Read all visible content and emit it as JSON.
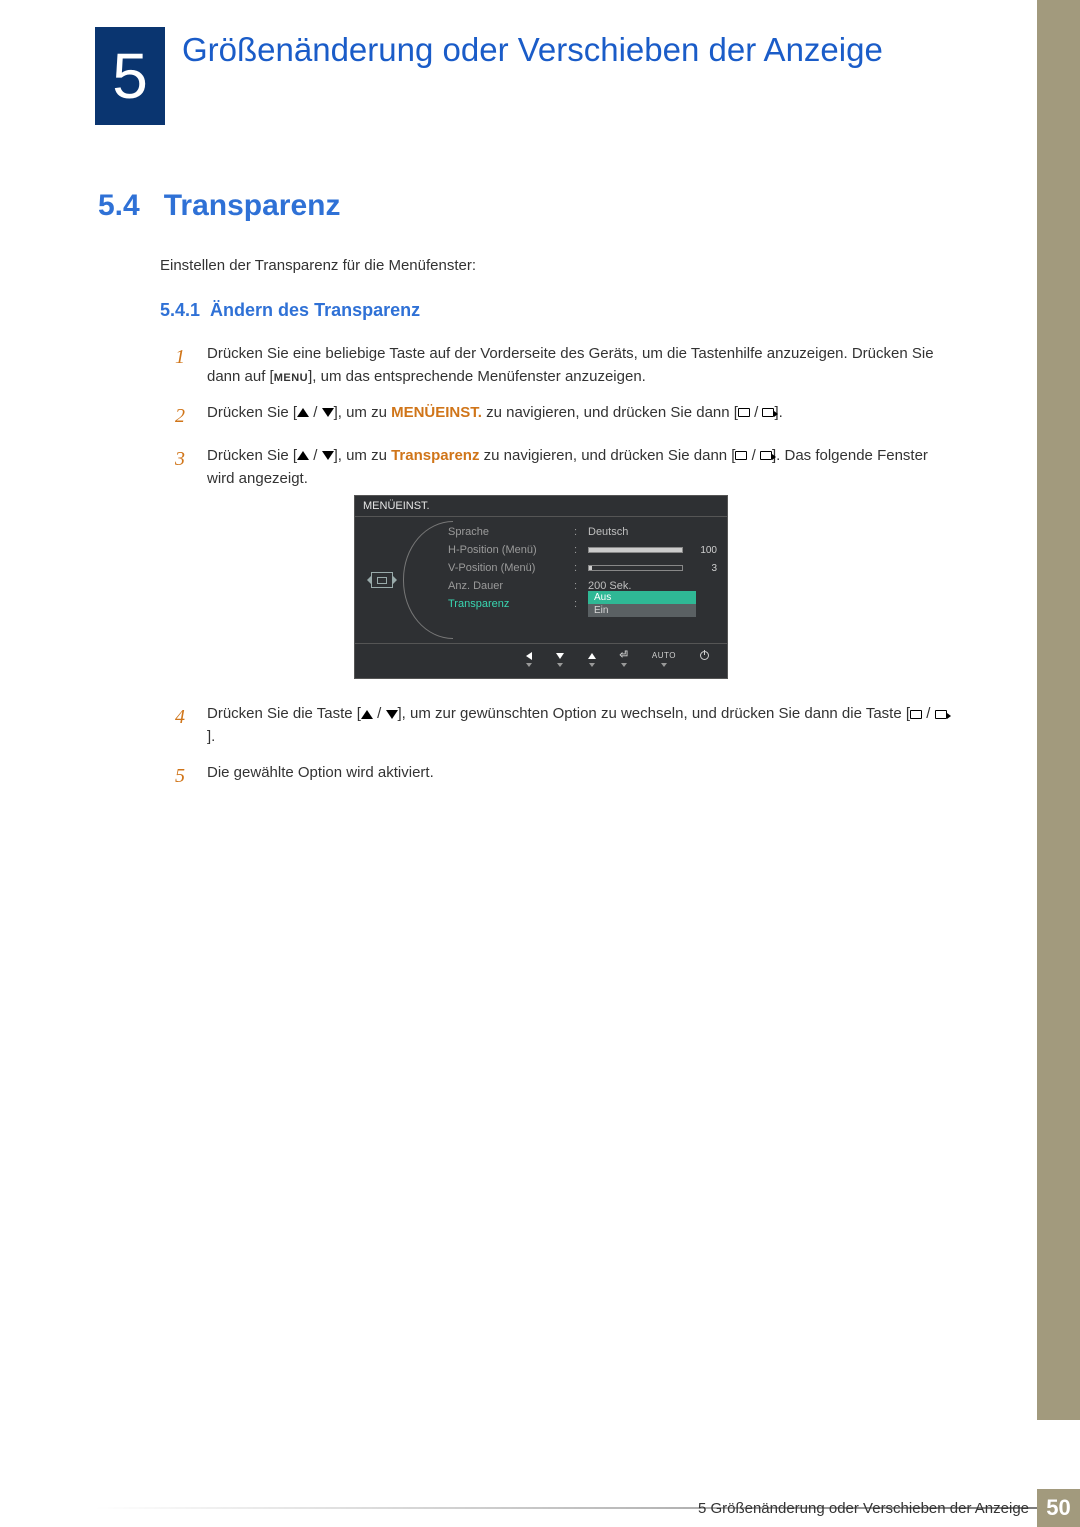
{
  "chapter": {
    "number": "5",
    "title": "Größenänderung oder Verschieben der Anzeige"
  },
  "section": {
    "number": "5.4",
    "title": "Transparenz"
  },
  "intro": "Einstellen der Transparenz für die Menüfenster:",
  "subsection": {
    "number": "5.4.1",
    "title": "Ändern des Transparenz"
  },
  "steps": {
    "s1_a": "Drücken Sie eine beliebige Taste auf der Vorderseite des Geräts, um die Tastenhilfe anzuzeigen. Drücken Sie dann auf [",
    "s1_menu": "MENU",
    "s1_b": "], um das entsprechende Menüfenster anzuzeigen.",
    "s2_a": "Drücken Sie [",
    "s2_b": "], um zu ",
    "s2_target": "MENÜEINST.",
    "s2_c": " zu navigieren, und drücken Sie dann [",
    "s2_d": "].",
    "s3_a": "Drücken Sie [",
    "s3_b": "], um zu ",
    "s3_target": "Transparenz",
    "s3_c": " zu navigieren, und drücken Sie dann [",
    "s3_d": "]. Das folgende Fenster wird angezeigt.",
    "s4_a": "Drücken Sie die Taste [",
    "s4_b": "], um zur gewünschten Option zu wechseln, und drücken Sie dann die Taste [",
    "s4_c": "].",
    "s5": "Die gewählte Option wird aktiviert."
  },
  "step_nums": {
    "n1": "1",
    "n2": "2",
    "n3": "3",
    "n4": "4",
    "n5": "5"
  },
  "osd": {
    "title": "MENÜEINST.",
    "rows": {
      "lang_label": "Sprache",
      "lang_value": "Deutsch",
      "hpos_label": "H-Position (Menü)",
      "hpos_value": "100",
      "vpos_label": "V-Position (Menü)",
      "vpos_value": "3",
      "dur_label": "Anz. Dauer",
      "dur_value": "200 Sek.",
      "trans_label": "Transparenz",
      "trans_opt1": "Aus",
      "trans_opt2": "Ein"
    },
    "footer_auto": "AUTO"
  },
  "footer": {
    "text": "5 Größenänderung oder Verschieben der Anzeige",
    "page": "50"
  }
}
